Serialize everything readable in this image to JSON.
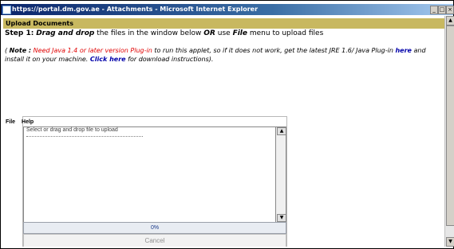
{
  "window": {
    "title": "https://portal.dm.gov.ae - Attachments - Microsoft Internet Explorer",
    "minimize": "_",
    "maximize": "□",
    "close": "×"
  },
  "page": {
    "banner": "Upload Documents",
    "step": {
      "label": "Step 1:",
      "drag_drop": "Drag and drop",
      "text1": "the files in the window below",
      "or": "OR",
      "text2": "use",
      "file": "File",
      "text3": "menu to upload files"
    },
    "note": {
      "open": "(",
      "label": "Note :",
      "red": "Need Java 1.4 or later version Plug-in",
      "text1": "to run this applet, so if it does not work, get the latest JRE 1.6/ Java Plug-in",
      "here": "here",
      "text2": "and install it on your machine.",
      "click_here": "Click here",
      "text3": "for download instructions)."
    }
  },
  "applet": {
    "menu": [
      "File",
      "Help"
    ],
    "drop_prompt": "Select or drag and drop file to upload",
    "progress_text": "0%",
    "progress_value": 0,
    "cancel_label": "Cancel"
  },
  "icons": {
    "scroll_up": "▲",
    "scroll_down": "▼"
  }
}
